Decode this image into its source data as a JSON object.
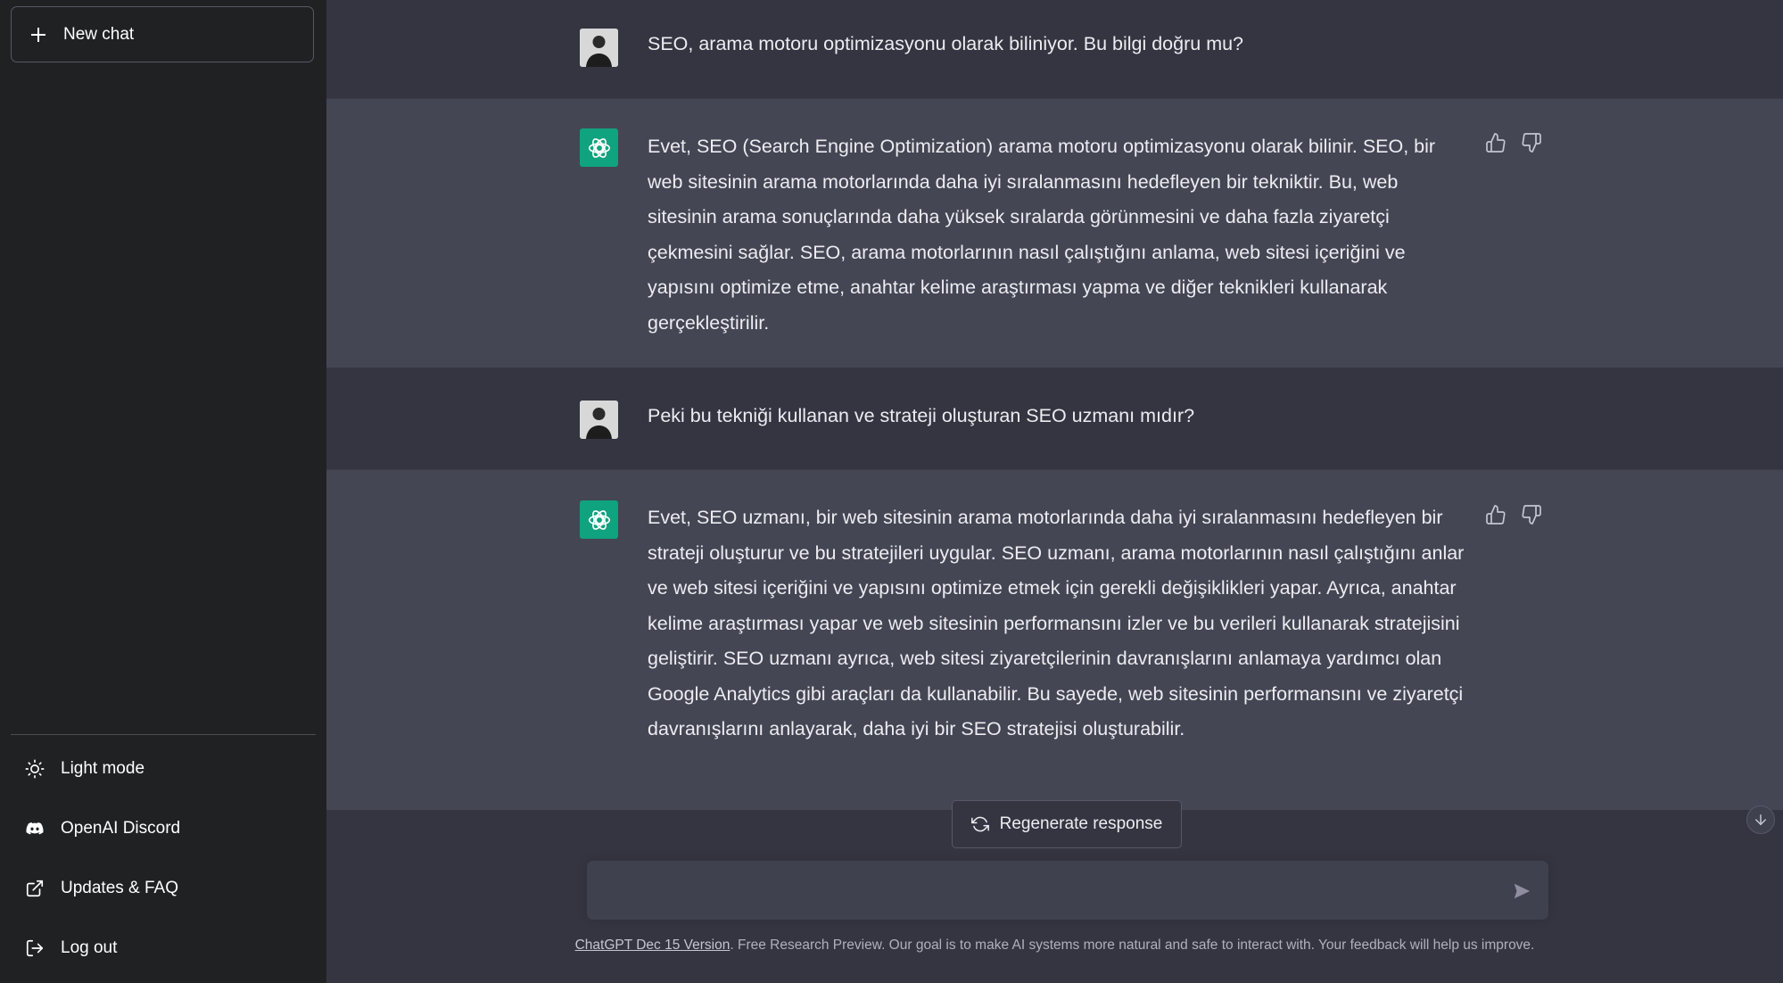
{
  "sidebar": {
    "new_chat_label": "New chat",
    "items": [
      {
        "label": "Light mode",
        "icon": "sun-icon"
      },
      {
        "label": "OpenAI Discord",
        "icon": "discord-icon"
      },
      {
        "label": "Updates & FAQ",
        "icon": "external-link-icon"
      },
      {
        "label": "Log out",
        "icon": "logout-icon"
      }
    ]
  },
  "conversation": [
    {
      "role": "user",
      "text": "SEO, arama motoru optimizasyonu olarak biliniyor. Bu bilgi doğru mu?"
    },
    {
      "role": "assistant",
      "text": "Evet, SEO (Search Engine Optimization) arama motoru optimizasyonu olarak bilinir. SEO, bir web sitesinin arama motorlarında daha iyi sıralanmasını hedefleyen bir tekniktir. Bu, web sitesinin arama sonuçlarında daha yüksek sıralarda görünmesini ve daha fazla ziyaretçi çekmesini sağlar. SEO, arama motorlarının nasıl çalıştığını anlama, web sitesi içeriğini ve yapısını optimize etme, anahtar kelime araştırması yapma ve diğer teknikleri kullanarak gerçekleştirilir."
    },
    {
      "role": "user",
      "text": "Peki bu tekniği kullanan ve strateji oluşturan SEO uzmanı mıdır?"
    },
    {
      "role": "assistant",
      "text": "Evet, SEO uzmanı, bir web sitesinin arama motorlarında daha iyi sıralanmasını hedefleyen bir strateji oluşturur ve bu stratejileri uygular. SEO uzmanı, arama motorlarının nasıl çalıştığını anlar ve web sitesi içeriğini ve yapısını optimize etmek için gerekli değişiklikleri yapar. Ayrıca, anahtar kelime araştırması yapar ve web sitesinin performansını izler ve bu verileri kullanarak stratejisini geliştirir. SEO uzmanı ayrıca, web sitesi ziyaretçilerinin davranışlarını anlamaya yardımcı olan Google Analytics gibi araçları da kullanabilir. Bu sayede, web sitesinin performansını ve ziyaretçi davranışlarını anlayarak, daha iyi bir SEO stratejisi oluşturabilir."
    }
  ],
  "composer": {
    "regenerate_label": "Regenerate response",
    "input_value": "",
    "input_placeholder": ""
  },
  "footer": {
    "version_link": "ChatGPT Dec 15 Version",
    "text": ". Free Research Preview. Our goal is to make AI systems more natural and safe to interact with. Your feedback will help us improve."
  },
  "colors": {
    "sidebar_bg": "#202123",
    "main_bg": "#343541",
    "assistant_row_bg": "#444654",
    "assistant_avatar": "#10a37f"
  }
}
